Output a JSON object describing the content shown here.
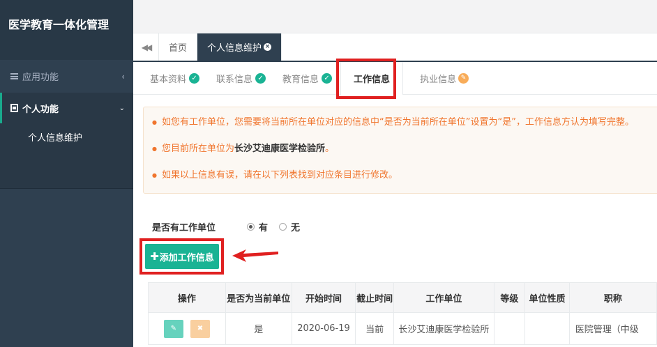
{
  "app": {
    "title": "医学教育一体化管理"
  },
  "sidebar": {
    "groups": [
      {
        "label": "应用功能",
        "icon": "list-icon",
        "expanded": false
      },
      {
        "label": "个人功能",
        "icon": "id-card-icon",
        "expanded": true,
        "items": [
          {
            "label": "个人信息维护"
          }
        ]
      }
    ]
  },
  "tabs": [
    {
      "label": "首页",
      "active": false
    },
    {
      "label": "个人信息维护",
      "active": true
    }
  ],
  "steps": [
    {
      "label": "基本资料",
      "status": "done"
    },
    {
      "label": "联系信息",
      "status": "done"
    },
    {
      "label": "教育信息",
      "status": "done"
    },
    {
      "label": "工作信息",
      "status": "active"
    },
    {
      "label": "执业信息",
      "status": "edit"
    }
  ],
  "notice": {
    "line1": "如您有工作单位，您需要将当前所在单位对应的信息中“是否为当前所在单位”设置为“是”，工作信息方认为填写完整。",
    "line2_prefix": "您目前所在单位为",
    "line2_unit": "长沙艾迪康医学检验所",
    "line2_suffix": "。",
    "line3": "如果以上信息有误，请在以下列表找到对应条目进行修改。"
  },
  "work_unit_question": {
    "label": "是否有工作单位",
    "options": [
      {
        "label": "有",
        "checked": true
      },
      {
        "label": "无",
        "checked": false
      }
    ]
  },
  "add_button": {
    "label": "添加工作信息"
  },
  "table": {
    "headers": [
      "操作",
      "是否为当前单位",
      "开始时间",
      "截止时间",
      "工作单位",
      "等级",
      "单位性质",
      "职称"
    ],
    "rows": [
      {
        "is_current": "是",
        "start": "2020-06-19",
        "end": "当前",
        "unit": "长沙艾迪康医学检验所",
        "level": "",
        "nature": "",
        "title": "医院管理（中级"
      }
    ]
  },
  "colors": {
    "sidebar": "#2f4050",
    "accent": "#1ab394",
    "notice_text": "#f0752d",
    "highlight": "#e02020"
  }
}
